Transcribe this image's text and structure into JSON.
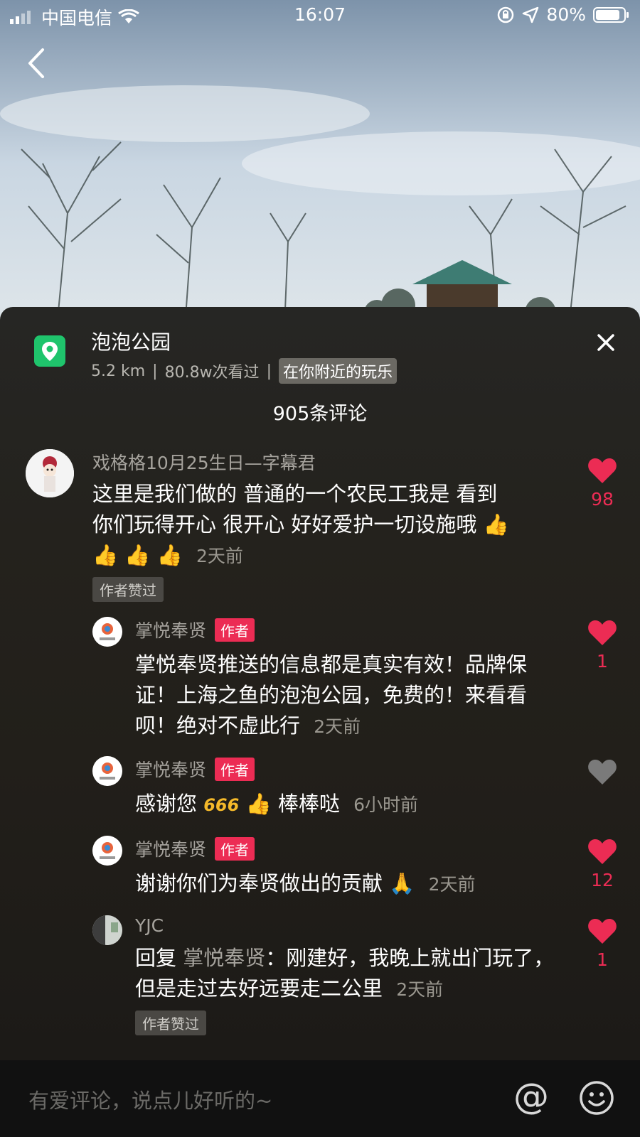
{
  "status_bar": {
    "carrier": "中国电信",
    "time": "16:07",
    "battery": "80%"
  },
  "location": {
    "title": "泡泡公园",
    "distance": "5.2 km",
    "separator": "|",
    "views": "80.8w次看过",
    "tag": "在你附近的玩乐"
  },
  "comments_count": "905条评论",
  "comments": [
    {
      "author": "戏格格10月25生日—字幕君",
      "text_line1": "这里是我们做的 普通的一个农民工我是 看到",
      "text_line2": "你们玩得开心 很开心 好好爱护一切设施哦",
      "time": "2天前",
      "liked_tag": "作者赞过",
      "likes": "98"
    },
    {
      "author": "掌悦奉贤",
      "badge": "作者",
      "text": "掌悦奉贤推送的信息都是真实有效！品牌保证！上海之鱼的泡泡公园，免费的！来看看呗！绝对不虚此行",
      "time": "2天前",
      "likes": "1"
    },
    {
      "author": "掌悦奉贤",
      "badge": "作者",
      "text_a": "感谢您",
      "text_b": "棒棒哒",
      "time": "6小时前",
      "likes": ""
    },
    {
      "author": "掌悦奉贤",
      "badge": "作者",
      "text": "谢谢你们为奉贤做出的贡献",
      "time": "2天前",
      "likes": "12"
    },
    {
      "author": "YJC",
      "reply_prefix": "回复",
      "reply_to": "掌悦奉贤",
      "text": "：刚建好，我晚上就出门玩了，但是走过去好远要走二公里",
      "time": "2天前",
      "liked_tag": "作者赞过",
      "likes": "1"
    }
  ],
  "footer": {
    "placeholder": "有爱评论，说点儿好听的~",
    "at_symbol": "@"
  },
  "colors": {
    "like_red": "#ec2c54",
    "location_green": "#1fc46c",
    "unliked_gray": "#7a7a7a"
  },
  "icons": [
    "signal-icon",
    "wifi-icon",
    "rotation-lock-icon",
    "location-arrow-icon",
    "battery-icon",
    "back-icon",
    "location-pin-icon",
    "close-icon",
    "heart-icon",
    "thumbs-up-emoji",
    "pray-emoji",
    "666-emoji",
    "smile-icon"
  ]
}
